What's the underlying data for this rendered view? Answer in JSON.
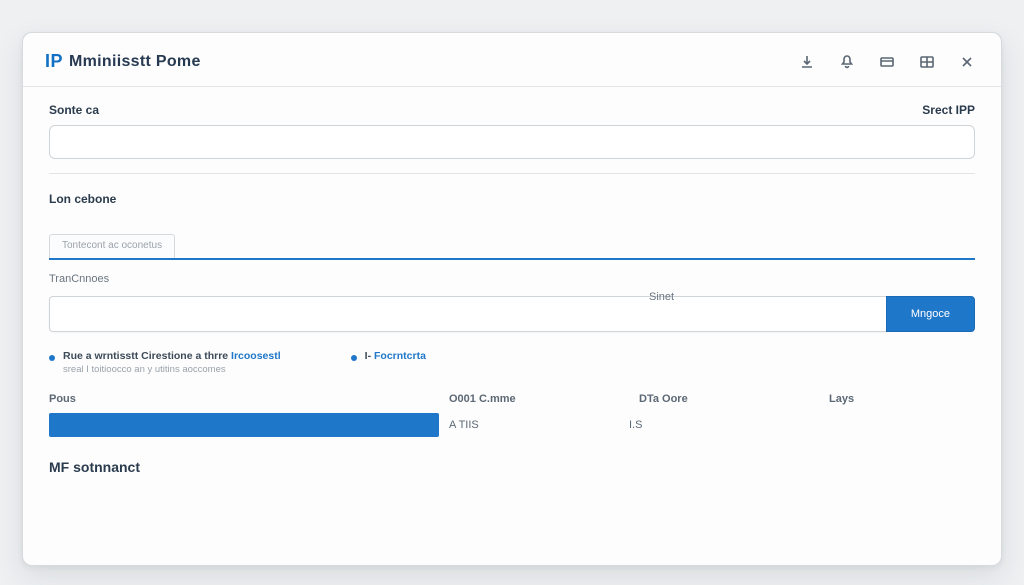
{
  "brand": {
    "mark": "IP",
    "title": "Mminiisstt Pome"
  },
  "header_icons": [
    "download-icon",
    "bell-icon",
    "card-icon",
    "grid-icon",
    "close-icon"
  ],
  "top_section": {
    "left_label": "Sonte ca",
    "right_label": "Srect IPP",
    "value": ""
  },
  "mid_section": {
    "label": "Lon cebone",
    "tabs": [
      {
        "label": "Tontecont ac oconetus"
      }
    ],
    "field_label_left": "TranCnnoes",
    "field_label_right": "Sinet",
    "input_value": "",
    "action_button": "Mngoce"
  },
  "tips": [
    {
      "title_pre": "Rue a wrntisstt Cirestione a thrre",
      "title_kw": "Ircoosestl",
      "subtitle": "sreal I toitioocco an y utitins aoccomes"
    },
    {
      "title_pre": "I-",
      "title_kw": "Focrntcrta",
      "subtitle": ""
    }
  ],
  "data_table": {
    "headers": [
      "Pous",
      "O001 C.mme",
      "DTa Oore",
      "Lays"
    ],
    "row": {
      "c2": "A TIIS",
      "c3": "I.S",
      "c4": ""
    }
  },
  "footer_label": "MF sotnnanct"
}
